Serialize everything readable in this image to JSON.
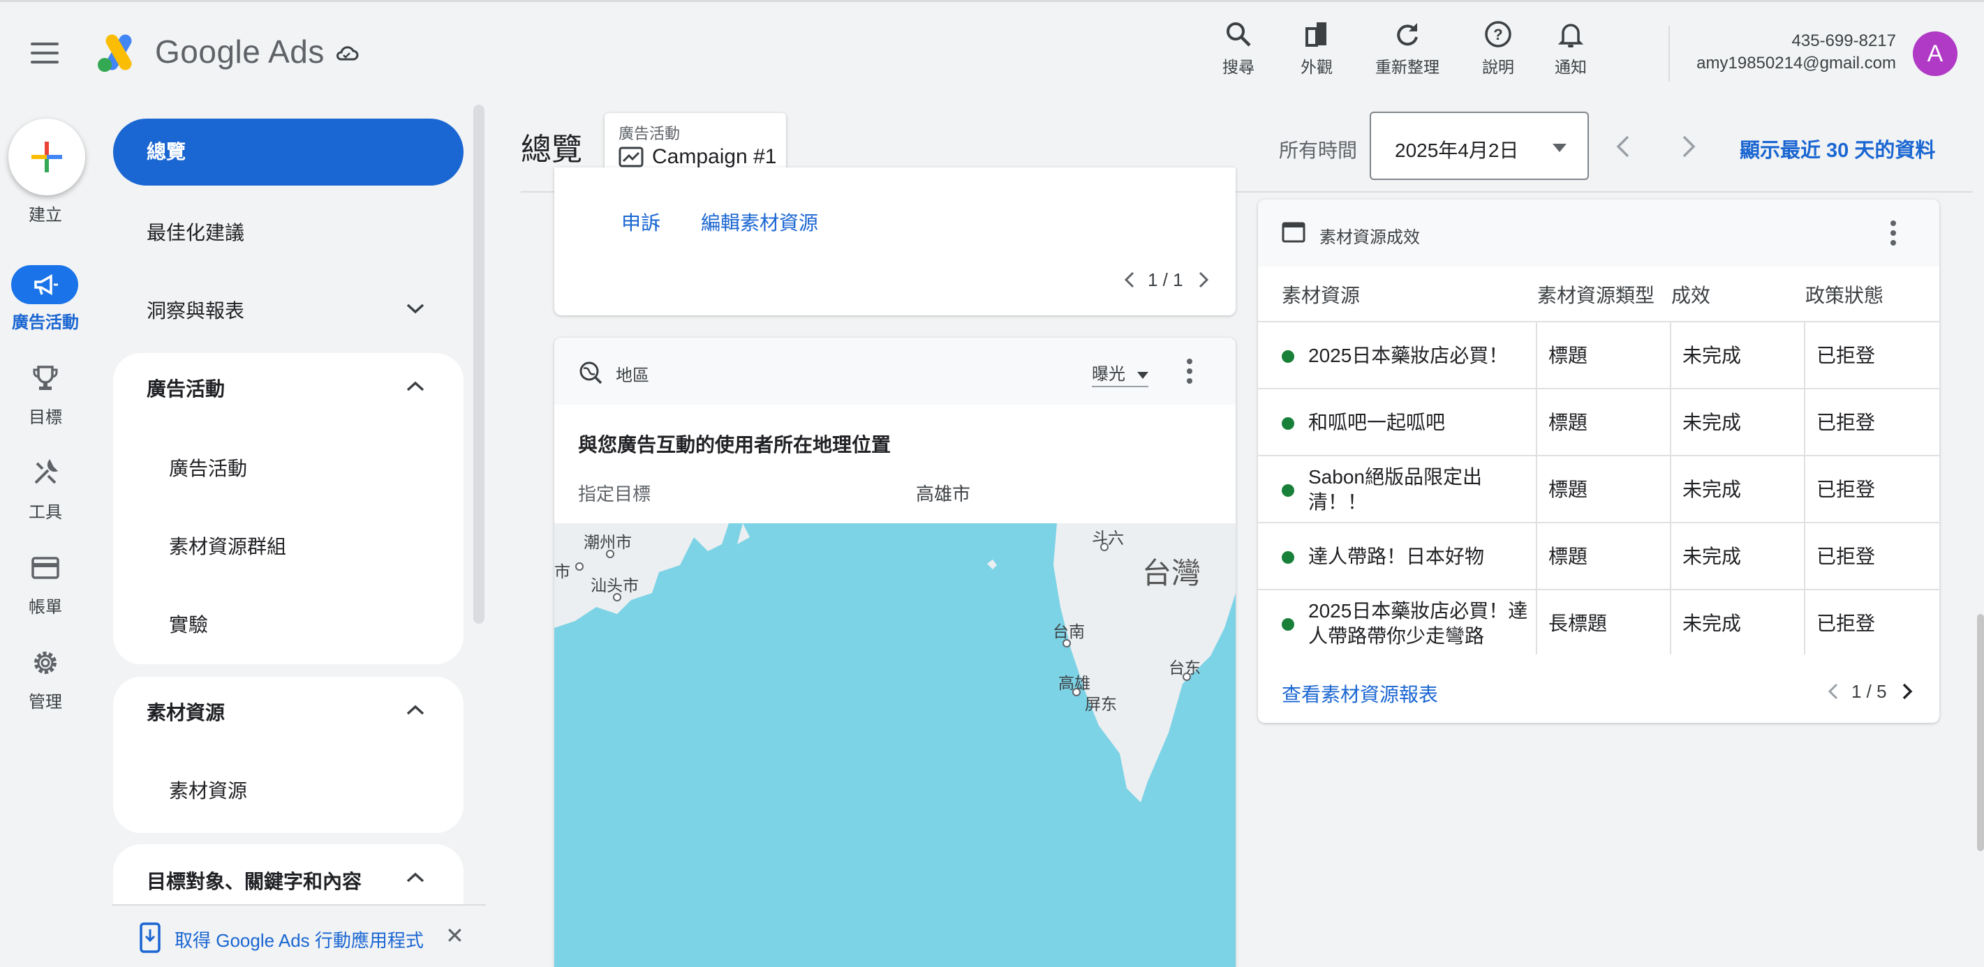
{
  "app": {
    "brand": "Google Ads",
    "brand_colors": {
      "blue": "#4285f4",
      "yellow": "#fbbc04",
      "green": "#34a853",
      "red": "#ea4335"
    },
    "accent": "#1a66d2"
  },
  "topbar": {
    "tools": [
      {
        "label": "搜尋",
        "icon": "search-icon"
      },
      {
        "label": "外觀",
        "icon": "appearance-icon"
      },
      {
        "label": "重新整理",
        "icon": "refresh-icon"
      },
      {
        "label": "說明",
        "icon": "help-icon"
      },
      {
        "label": "通知",
        "icon": "bell-icon"
      }
    ],
    "account_phone": "435-699-8217",
    "account_email": "amy19850214@gmail.com",
    "avatar_letter": "A"
  },
  "rail": {
    "create_label": "建立",
    "items": [
      {
        "label": "廣告活動",
        "icon": "megaphone-icon",
        "active": true
      },
      {
        "label": "目標",
        "icon": "trophy-icon"
      },
      {
        "label": "工具",
        "icon": "tools-icon"
      },
      {
        "label": "帳單",
        "icon": "credit-card-icon"
      },
      {
        "label": "管理",
        "icon": "gear-icon"
      }
    ]
  },
  "nav": {
    "overview": "總覽",
    "recommendations": "最佳化建議",
    "insights": "洞察與報表",
    "campaigns_section": "廣告活動",
    "campaigns_items": [
      "廣告活動",
      "素材資源群組",
      "實驗"
    ],
    "assets_section": "素材資源",
    "assets_items": [
      "素材資源"
    ],
    "targeting_section": "目標對象、關鍵字和內容",
    "app_banner": "取得 Google Ads 行動應用程式"
  },
  "header": {
    "title": "總覽",
    "campaign_chip_label": "廣告活動",
    "campaign_chip_value": "Campaign #1",
    "range_label": "所有時間",
    "date_value": "2025年4月2日",
    "last30_link": "顯示最近 30 天的資料"
  },
  "top_card": {
    "appeal_link": "申訴",
    "edit_link": "編輯素材資源",
    "pager": "1 / 1"
  },
  "geo_card": {
    "title": "地區",
    "metric": "曝光",
    "subtitle": "與您廣告互動的使用者所在地理位置",
    "col_target": "指定目標",
    "col_value": "高雄市",
    "map_labels": [
      "潮州市",
      "市",
      "汕头市",
      "斗六",
      "台灣",
      "台南",
      "台东",
      "高雄",
      "屏东"
    ]
  },
  "asset_card": {
    "title": "素材資源成效",
    "columns": [
      "素材資源",
      "素材資源類型",
      "成效",
      "政策狀態"
    ],
    "rows": [
      {
        "asset": "2025日本藥妝店必買！",
        "type": "標題",
        "perf": "未完成",
        "policy": "已拒登"
      },
      {
        "asset": "和呱吧一起呱吧",
        "type": "標題",
        "perf": "未完成",
        "policy": "已拒登"
      },
      {
        "asset": "Sabon絕版品限定出清！！",
        "type": "標題",
        "perf": "未完成",
        "policy": "已拒登"
      },
      {
        "asset": "達人帶路！日本好物",
        "type": "標題",
        "perf": "未完成",
        "policy": "已拒登"
      },
      {
        "asset": "2025日本藥妝店必買！達人帶路帶你少走彎路",
        "type": "長標題",
        "perf": "未完成",
        "policy": "已拒登"
      }
    ],
    "report_link": "查看素材資源報表",
    "pager": "1 / 5"
  }
}
